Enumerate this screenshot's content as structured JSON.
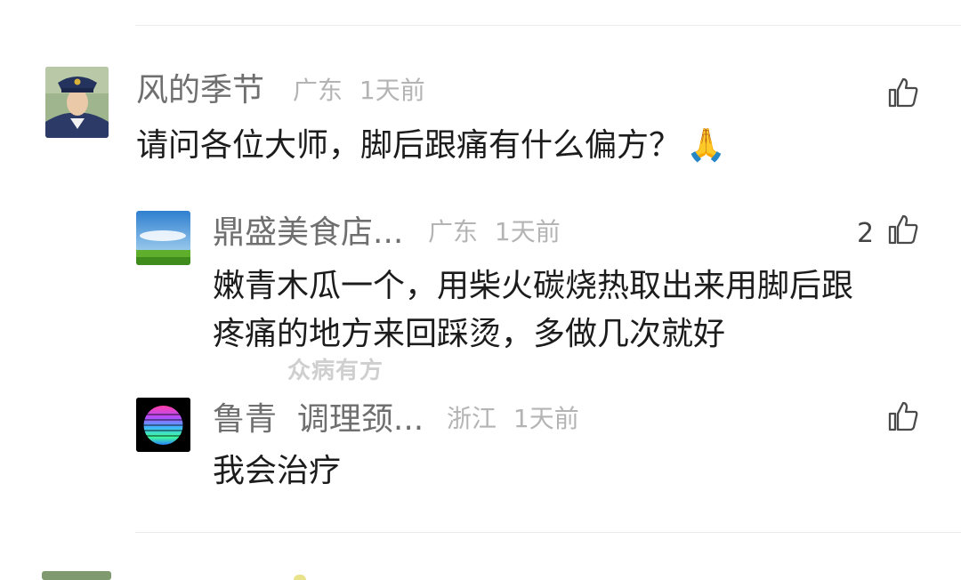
{
  "comments": [
    {
      "username": "风的季节",
      "location": "广东",
      "time": "1天前",
      "text": "请问各位大师，脚后跟痛有什么偏方？",
      "emoji": "🙏",
      "avatar_icon": "police-officer-avatar"
    }
  ],
  "replies": [
    {
      "username": "鼎盛美食店...",
      "location": "广东",
      "time": "1天前",
      "like_count": "2",
      "text_lines": [
        "嫩青木瓜一个，用柴火碳烧热取出来用脚后跟",
        "疼痛的地方来回踩烫，多做几次就好"
      ],
      "avatar_icon": "sky-grassland-avatar"
    },
    {
      "username": "鲁青  调理颈...",
      "location": "浙江",
      "time": "1天前",
      "text": "我会治疗",
      "avatar_icon": "colorful-sphere-avatar"
    }
  ],
  "watermark": "众病有方",
  "colors": {
    "username": "#6f6f6f",
    "meta": "#b4b4b4",
    "body_text": "#1c1c1c",
    "divider": "#ececec"
  }
}
